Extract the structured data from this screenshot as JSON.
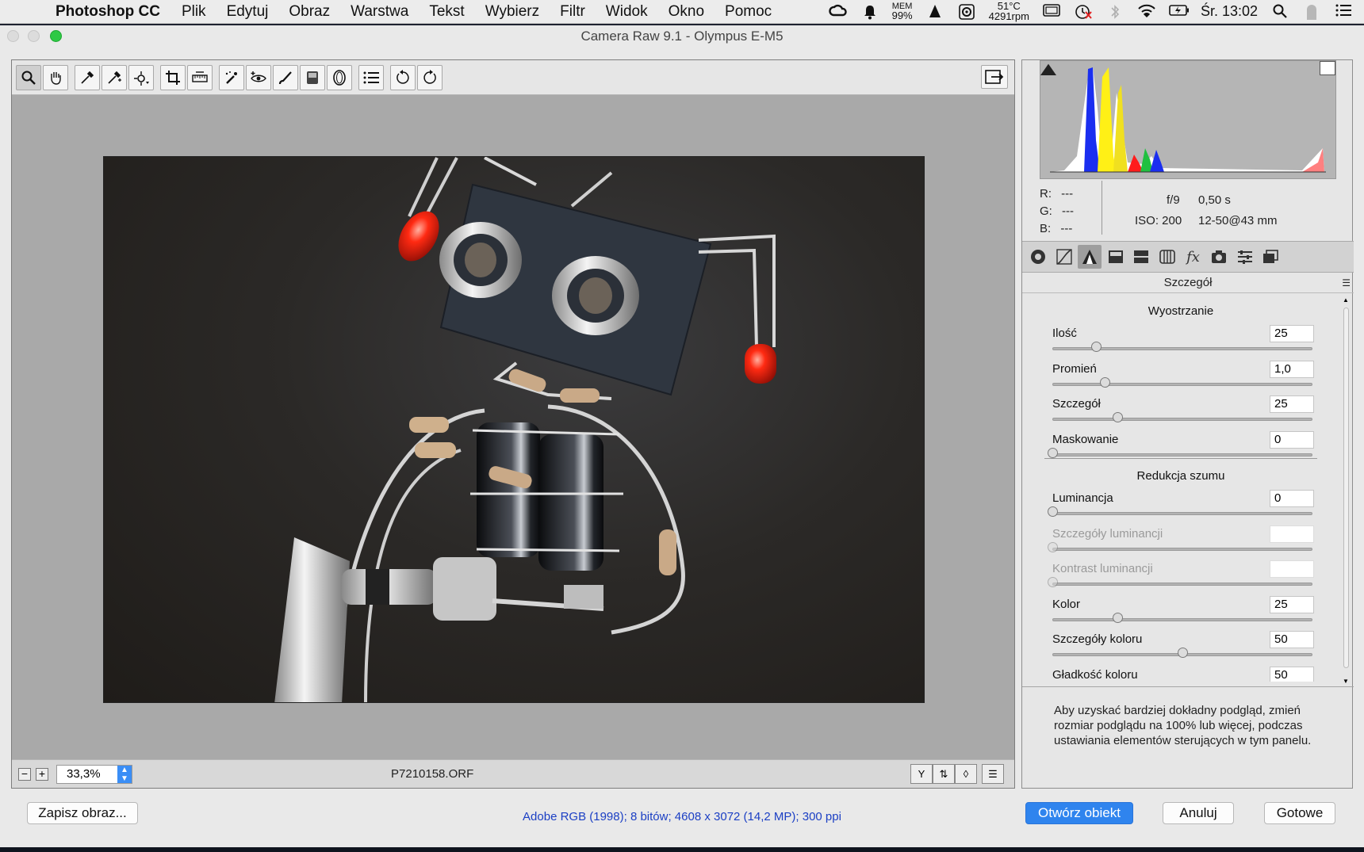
{
  "menubar": {
    "app": "Photoshop CC",
    "items": [
      "Plik",
      "Edytuj",
      "Obraz",
      "Warstwa",
      "Tekst",
      "Wybierz",
      "Filtr",
      "Widok",
      "Okno",
      "Pomoc"
    ],
    "mem_label": "MEM",
    "mem_value": "99%",
    "temp": "51°C",
    "rpm": "4291rpm",
    "clock": "Śr. 13:02"
  },
  "window": {
    "title": "Camera Raw 9.1  -  Olympus E-M5"
  },
  "preview": {
    "zoom": "33,3%",
    "filename": "P7210158.ORF"
  },
  "readout": {
    "r_label": "R:",
    "r_value": "---",
    "g_label": "G:",
    "g_value": "---",
    "b_label": "B:",
    "b_value": "---",
    "aperture": "f/9",
    "shutter": "0,50 s",
    "iso": "ISO: 200",
    "lens": "12-50@43 mm"
  },
  "panel": {
    "title": "Szczegół",
    "sharpening_title": "Wyostrzanie",
    "noise_title": "Redukcja szumu",
    "sharpening": [
      {
        "label": "Ilość",
        "value": "25",
        "level": 0.167
      },
      {
        "label": "Promień",
        "value": "1,0",
        "level": 0.2
      },
      {
        "label": "Szczegół",
        "value": "25",
        "level": 0.25
      },
      {
        "label": "Maskowanie",
        "value": "0",
        "level": 0
      }
    ],
    "noise": [
      {
        "label": "Luminancja",
        "value": "0",
        "level": 0,
        "disabled": false
      },
      {
        "label": "Szczegóły luminancji",
        "value": "",
        "level": 0,
        "disabled": true
      },
      {
        "label": "Kontrast luminancji",
        "value": "",
        "level": 0,
        "disabled": true
      },
      {
        "label": "Kolor",
        "value": "25",
        "level": 0.25,
        "disabled": false
      },
      {
        "label": "Szczegóły koloru",
        "value": "50",
        "level": 0.5,
        "disabled": false
      },
      {
        "label": "Gładkość koloru",
        "value": "50",
        "level": 0.5,
        "disabled": false
      }
    ],
    "hint": "Aby uzyskać bardziej dokładny podgląd, zmień rozmiar podglądu na 100% lub więcej, podczas ustawiania elementów sterujących w tym panelu."
  },
  "footer": {
    "save_label": "Zapisz obraz...",
    "color_info": "Adobe RGB (1998); 8 bitów; 4608 x 3072 (14,2 MP); 300 ppi",
    "open_label": "Otwórz obiekt",
    "cancel_label": "Anuluj",
    "done_label": "Gotowe"
  },
  "colors": {
    "accent": "#2f84ee",
    "link": "#1b3fc4"
  }
}
